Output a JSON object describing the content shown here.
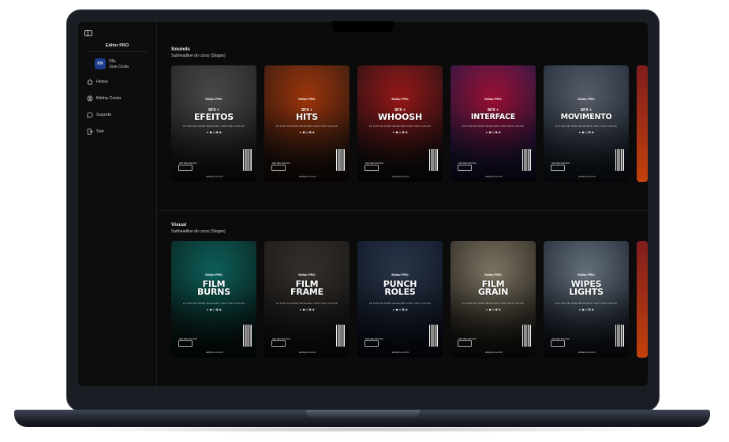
{
  "app": {
    "brand": "Editor PRO"
  },
  "user": {
    "greeting": "Olá,",
    "name": "Jose Costa",
    "avatar_initials": "KN"
  },
  "sidebar": {
    "items": [
      {
        "label": "Home",
        "icon": "home-icon"
      },
      {
        "label": "Minha Conta",
        "icon": "user-icon"
      },
      {
        "label": "Suporte",
        "icon": "whatsapp-icon"
      },
      {
        "label": "Sair",
        "icon": "exit-icon"
      }
    ]
  },
  "sections": [
    {
      "title": "Sounds",
      "subtitle": "Subheadline do curso (Slogan)",
      "cards": [
        {
          "prefix": "SFX +",
          "title": "EFEITOS",
          "colors": [
            "#5a5a5a",
            "#222222"
          ]
        },
        {
          "prefix": "SFX +",
          "title": "HITS",
          "colors": [
            "#c2410c",
            "#2b1a14"
          ]
        },
        {
          "prefix": "SFX +",
          "title": "WHOOSH",
          "colors": [
            "#b91c1c",
            "#1f1416"
          ]
        },
        {
          "prefix": "SFX +",
          "title": "INTERFACE",
          "colors": [
            "#be123c",
            "#1e1b4b"
          ]
        },
        {
          "prefix": "SFX +",
          "title": "MOVIMENTO",
          "colors": [
            "#6b7280",
            "#1f2937"
          ]
        }
      ]
    },
    {
      "title": "Visual",
      "subtitle": "Subheadline do curso (Slogan)",
      "cards": [
        {
          "prefix": "",
          "title": "FILM BURNS",
          "colors": [
            "#0f766e",
            "#0b1f1d"
          ]
        },
        {
          "prefix": "",
          "title": "FILM FRAME",
          "colors": [
            "#3f3a36",
            "#1b1917"
          ]
        },
        {
          "prefix": "",
          "title": "PUNCH ROLES",
          "colors": [
            "#334155",
            "#0f172a"
          ]
        },
        {
          "prefix": "",
          "title": "FILM GRAIN",
          "colors": [
            "#9a8f7a",
            "#2a261f"
          ]
        },
        {
          "prefix": "",
          "title": "WIPES LIGHTS",
          "colors": [
            "#7c8a99",
            "#1c2330"
          ]
        }
      ]
    }
  ],
  "card_common": {
    "logo": "Editor PRO",
    "tagline": "20 FIOS DE SOMS SELECOES COM TUDO LOCAIS",
    "icons": "▲ ◼ ◎ ▣ ◉",
    "number": "028 000 000 000",
    "site": "editorpro.com.br"
  },
  "partial_card_colors": [
    "#7f1d1d",
    "#c2410c"
  ]
}
